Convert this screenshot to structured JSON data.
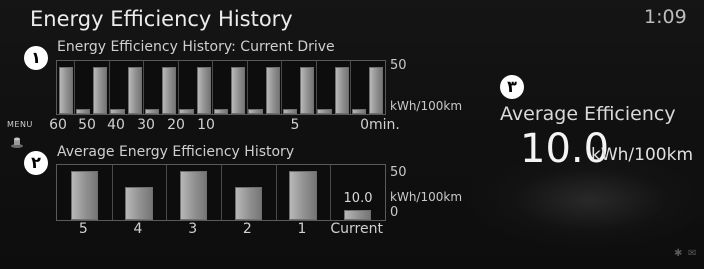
{
  "header": {
    "title": "Energy Efficiency History",
    "clock": "1:09"
  },
  "badges": {
    "one": "١",
    "two": "٢",
    "three": "٣"
  },
  "current_drive": {
    "title": "Energy Efficiency History: Current Drive",
    "y_max_label": "50",
    "unit_label": "kWh/100km",
    "x_ticks": [
      "60",
      "50",
      "40",
      "30",
      "20",
      "10",
      "5",
      "0min."
    ]
  },
  "average_history": {
    "title": "Average Energy Efficiency History",
    "y_max_label": "50",
    "unit_label": "kWh/100km",
    "y_min_label": "0",
    "current_value_label": "10.0",
    "categories": [
      "5",
      "4",
      "3",
      "2",
      "1",
      "Current"
    ]
  },
  "menu": {
    "label": "MENU"
  },
  "average_efficiency": {
    "label": "Average Efficiency",
    "value": "10.0",
    "unit": "kWh/100km"
  },
  "chart_data": [
    {
      "type": "bar",
      "title": "Energy Efficiency History: Current Drive",
      "ylabel": "kWh/100km",
      "ylim": [
        0,
        50
      ],
      "x_ticks": [
        "60",
        "50",
        "40",
        "30",
        "20",
        "10",
        "5",
        "0min."
      ],
      "values": [
        48,
        5,
        48,
        5,
        48,
        5,
        48,
        5,
        48,
        5,
        48,
        5,
        48,
        5,
        48,
        5,
        48,
        5,
        48
      ]
    },
    {
      "type": "bar",
      "title": "Average Energy Efficiency History",
      "ylabel": "kWh/100km",
      "ylim": [
        0,
        50
      ],
      "categories": [
        "5",
        "4",
        "3",
        "2",
        "1",
        "Current"
      ],
      "values": [
        48,
        32,
        48,
        32,
        48,
        10
      ]
    }
  ],
  "colors": {
    "background": "#111111",
    "bar": "#a8a8a8",
    "badge": "#ffffff"
  },
  "icons": {
    "menu_knob": "joystick-icon",
    "bluetooth": "bluetooth-icon",
    "signal": "signal-icon"
  }
}
